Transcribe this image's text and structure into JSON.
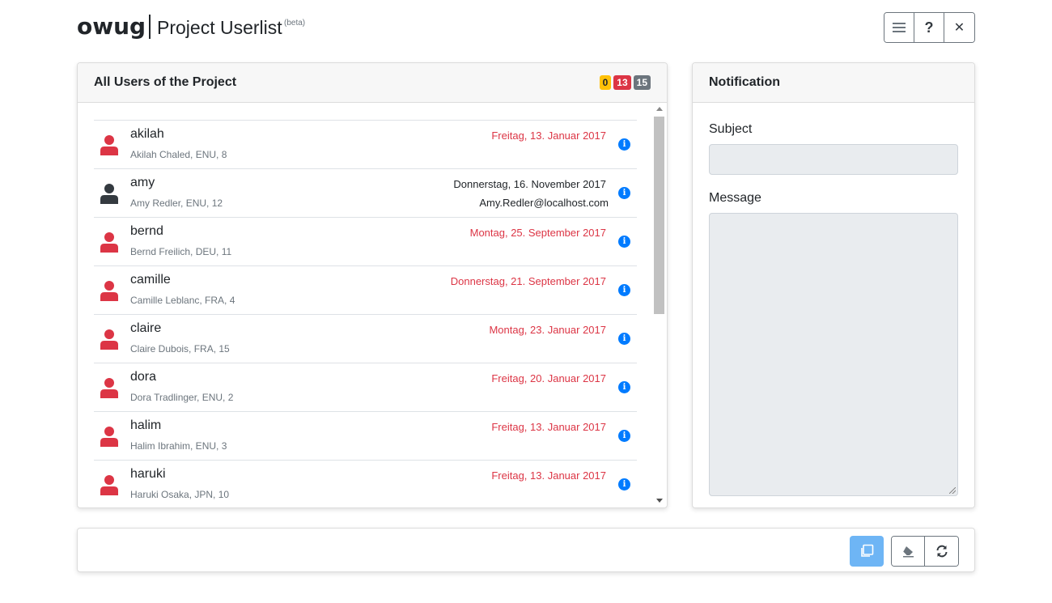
{
  "header": {
    "brand": "owug",
    "title": "Project Userlist",
    "beta": "(beta)",
    "buttons": [
      {
        "icon": "menu-icon"
      },
      {
        "label": "?",
        "icon": "help-icon"
      },
      {
        "label": "✕",
        "icon": "close-icon"
      }
    ]
  },
  "users_card": {
    "title": "All Users of the Project",
    "badges": {
      "warning": "0",
      "danger": "13",
      "total": "15"
    },
    "users": [
      {
        "username": "akilah",
        "details": "Akilah Chaled, ENU, 8",
        "date": "Freitag, 13. Januar 2017",
        "status": "expired",
        "email": ""
      },
      {
        "username": "amy",
        "details": "Amy Redler, ENU, 12",
        "date": "Donnerstag, 16. November 2017",
        "status": "active",
        "email": "Amy.Redler@localhost.com"
      },
      {
        "username": "bernd",
        "details": "Bernd Freilich, DEU, 11",
        "date": "Montag, 25. September 2017",
        "status": "expired",
        "email": ""
      },
      {
        "username": "camille",
        "details": "Camille Leblanc, FRA, 4",
        "date": "Donnerstag, 21. September 2017",
        "status": "expired",
        "email": ""
      },
      {
        "username": "claire",
        "details": "Claire Dubois, FRA, 15",
        "date": "Montag, 23. Januar 2017",
        "status": "expired",
        "email": ""
      },
      {
        "username": "dora",
        "details": "Dora Tradlinger, ENU, 2",
        "date": "Freitag, 20. Januar 2017",
        "status": "expired",
        "email": ""
      },
      {
        "username": "halim",
        "details": "Halim Ibrahim, ENU, 3",
        "date": "Freitag, 13. Januar 2017",
        "status": "expired",
        "email": ""
      },
      {
        "username": "haruki",
        "details": "Haruki Osaka, JPN, 10",
        "date": "Freitag, 13. Januar 2017",
        "status": "expired",
        "email": ""
      }
    ]
  },
  "notification": {
    "title": "Notification",
    "subject_label": "Subject",
    "subject_value": "",
    "message_label": "Message",
    "message_value": ""
  },
  "footer": {
    "buttons": [
      {
        "icon": "copy-icon"
      },
      {
        "icon": "eraser-icon"
      },
      {
        "icon": "refresh-icon"
      }
    ]
  },
  "colors": {
    "expired": "#dc3545",
    "active": "#343a40",
    "info": "#007bff",
    "primary_light": "#6eb5f5"
  }
}
